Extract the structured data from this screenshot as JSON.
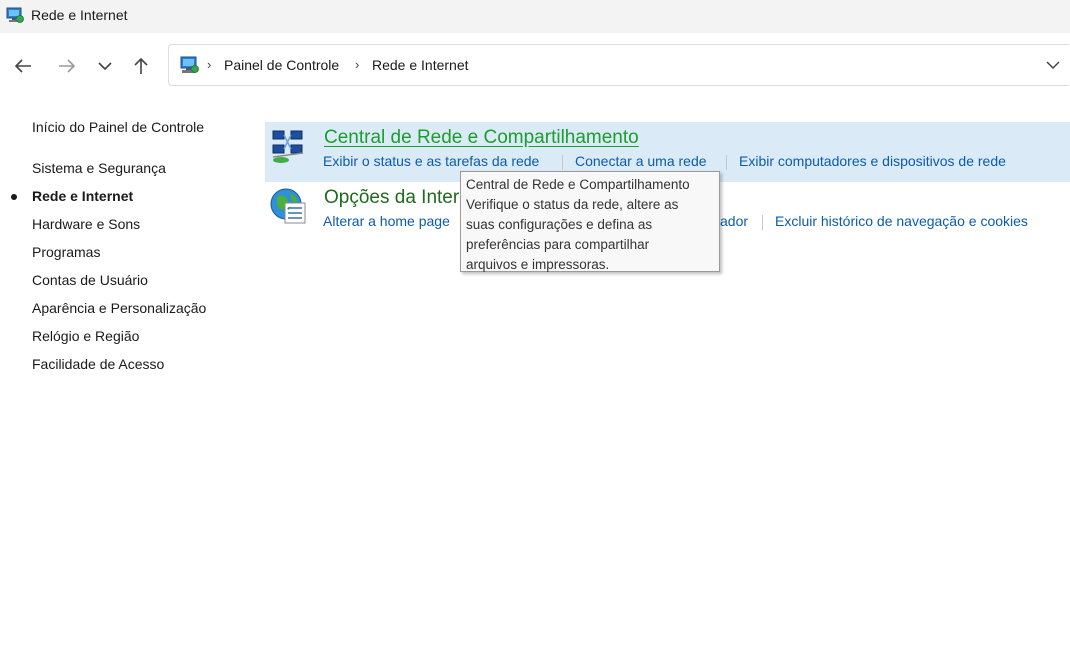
{
  "window": {
    "title": "Rede e Internet"
  },
  "address_bar": {
    "breadcrumbs": [
      "Painel de Controle",
      "Rede e Internet"
    ]
  },
  "sidebar": {
    "home": "Início do Painel de Controle",
    "items": [
      {
        "label": "Sistema e Segurança",
        "active": false
      },
      {
        "label": "Rede e Internet",
        "active": true
      },
      {
        "label": "Hardware e Sons",
        "active": false
      },
      {
        "label": "Programas",
        "active": false
      },
      {
        "label": "Contas de Usuário",
        "active": false
      },
      {
        "label": "Aparência e Personalização",
        "active": false
      },
      {
        "label": "Relógio e Região",
        "active": false
      },
      {
        "label": "Facilidade de Acesso",
        "active": false
      }
    ]
  },
  "categories": [
    {
      "title": "Central de Rede e Compartilhamento",
      "icon": "network-center-icon",
      "links": [
        "Exibir o status e as tarefas da rede",
        "Conectar a uma rede",
        "Exibir computadores e dispositivos de rede"
      ]
    },
    {
      "title_visible": "Opções da Inter",
      "icon": "internet-options-icon",
      "links_visible": [
        "Alterar a home page",
        "ador",
        "Excluir histórico de navegação e cookies"
      ]
    }
  ],
  "tooltip": {
    "lines": [
      "Central de Rede e Compartilhamento",
      "Verifique o status da rede, altere as",
      "suas configurações e defina as",
      "preferências para compartilhar",
      "arquivos e impressoras."
    ]
  },
  "colors": {
    "hover_highlight": "#dbeaf7",
    "link": "#0b5cad",
    "category_title_hover": "#1b9e2d",
    "category_title": "#1e6a1e"
  }
}
